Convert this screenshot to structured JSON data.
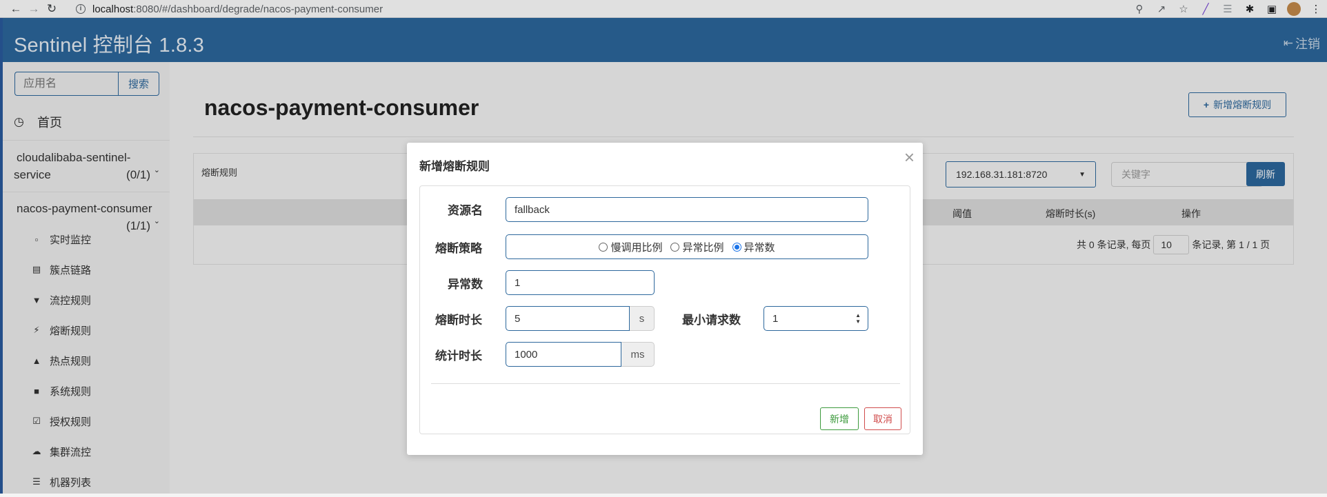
{
  "browser": {
    "url_host": "localhost",
    "url_path": ":8080/#/dashboard/degrade/nacos-payment-consumer",
    "icons": [
      "back-icon",
      "forward-icon",
      "reload-icon",
      "zoom-icon",
      "share-icon",
      "bookmark-star-icon",
      "extension-pen-icon",
      "extension-icon",
      "puzzle-icon",
      "sidepanel-icon",
      "avatar",
      "more-icon"
    ]
  },
  "header": {
    "title": "Sentinel 控制台 1.8.3",
    "logout_label": "注销"
  },
  "sidebar": {
    "search_placeholder": "应用名",
    "search_button": "搜索",
    "home_label": "首页",
    "apps": [
      {
        "name_line1": "cloudalibaba-sentinel-",
        "name_line2": "service",
        "count": "(0/1)"
      },
      {
        "name_line1": "nacos-payment-consumer",
        "name_line2": "",
        "count": "(1/1)"
      }
    ],
    "menu": [
      {
        "label": "实时监控",
        "icon": "bar-chart-icon"
      },
      {
        "label": "簇点链路",
        "icon": "list-icon"
      },
      {
        "label": "流控规则",
        "icon": "filter-icon"
      },
      {
        "label": "熔断规则",
        "icon": "flash-icon"
      },
      {
        "label": "热点规则",
        "icon": "fire-icon"
      },
      {
        "label": "系统规则",
        "icon": "lock-icon"
      },
      {
        "label": "授权规则",
        "icon": "check-square-icon"
      },
      {
        "label": "集群流控",
        "icon": "cloud-icon"
      },
      {
        "label": "机器列表",
        "icon": "list-bullets-icon"
      }
    ]
  },
  "main": {
    "page_title": "nacos-payment-consumer",
    "add_rule_button": "新增熔断规则",
    "panel_title": "熔断规则",
    "machine_select": "192.168.31.181:8720",
    "keyword_placeholder": "关键字",
    "refresh_button": "刷新",
    "table_headers": [
      "阈值",
      "熔断时长(s)",
      "操作"
    ],
    "pager": {
      "prefix": "共 0 条记录, 每页",
      "page_size": "10",
      "suffix": "条记录, 第 1 / 1 页"
    }
  },
  "modal": {
    "title": "新增熔断规则",
    "close": "×",
    "resource_label": "资源名",
    "resource_value": "fallback",
    "strategy_label": "熔断策略",
    "strategies": [
      "慢调用比例",
      "异常比例",
      "异常数"
    ],
    "selected_strategy": "异常数",
    "exception_count_label": "异常数",
    "exception_count_value": "1",
    "duration_label": "熔断时长",
    "duration_value": "5",
    "duration_unit": "s",
    "min_request_label": "最小请求数",
    "min_request_value": "1",
    "stat_label": "统计时长",
    "stat_value": "1000",
    "stat_unit": "ms",
    "ok_button": "新增",
    "cancel_button": "取消"
  }
}
